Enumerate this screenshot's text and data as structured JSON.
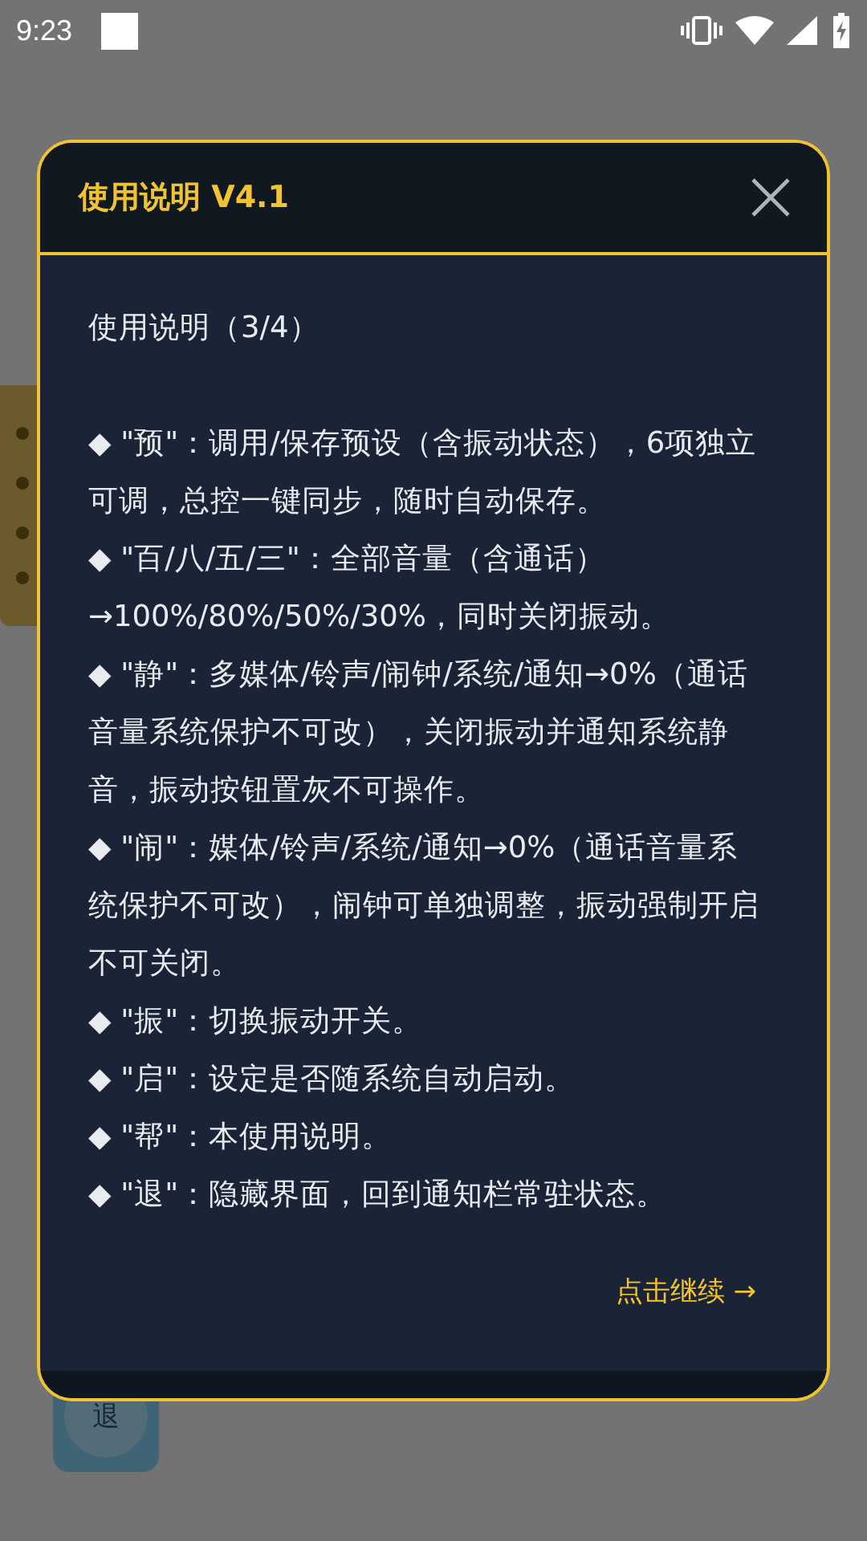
{
  "status_bar": {
    "time": "9:23"
  },
  "background": {
    "exit_button": "退"
  },
  "dialog": {
    "title": "使用说明 V4.1",
    "heading": "使用说明（3/4）",
    "items": [
      "◆ \"预\"：调用/保存预设（含振动状态），6项独立可调，总控一键同步，随时自动保存。",
      "◆ \"百/八/五/三\"：全部音量（含通话）→100%/80%/50%/30%，同时关闭振动。",
      "◆ \"静\"：多媒体/铃声/闹钟/系统/通知→0%（通话音量系统保护不可改），关闭振动并通知系统静音，振动按钮置灰不可操作。",
      "◆ \"闹\"：媒体/铃声/系统/通知→0%（通话音量系统保护不可改），闹钟可单独调整，振动强制开启不可关闭。",
      "◆ \"振\"：切换振动开关。",
      "◆ \"启\"：设定是否随系统自动启动。",
      "◆ \"帮\"：本使用说明。",
      "◆ \"退\"：隐藏界面，回到通知栏常驻状态。"
    ],
    "continue": "点击继续 →"
  }
}
